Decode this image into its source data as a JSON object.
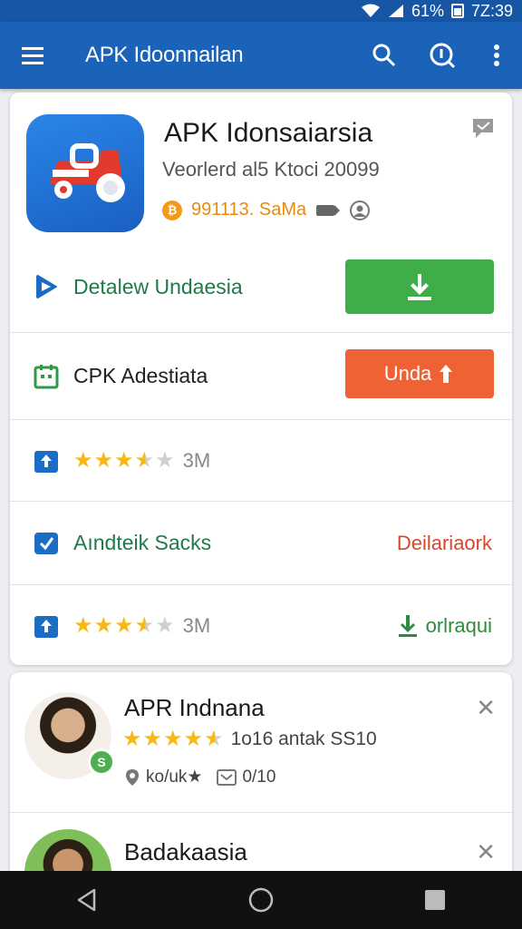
{
  "status_bar": {
    "battery": "61%",
    "time": "7Z:39"
  },
  "app_bar": {
    "title": "APK Idoonnailan"
  },
  "app": {
    "name": "APK Idonsaiarsia",
    "subtitle": "Veorlerd al5 Ktoci 20099",
    "count": "991113. SaMa"
  },
  "rows": [
    {
      "label": "Detalew Undaesia",
      "label_color": "#1e7a4a"
    },
    {
      "label": "CPK Adestiata",
      "button": "Unda"
    },
    {
      "rating": 3.5,
      "count": "3M"
    },
    {
      "label": "Aındteik Sacks",
      "label_color": "#1e7a4a",
      "action": "Deilariaork"
    },
    {
      "rating": 3.5,
      "count": "3M",
      "action": "orlraqui"
    }
  ],
  "people": [
    {
      "name": "APR Indnana",
      "rating": 4.5,
      "rating_text": "1o16 antak SS10",
      "meta1": "ko/uk★",
      "meta2": "0/10",
      "badge": "S"
    },
    {
      "name": "Badakaasia"
    }
  ],
  "colors": {
    "primary": "#1a63b8",
    "green": "#3fae49",
    "orange": "#ee6233",
    "star": "#f6b915"
  }
}
